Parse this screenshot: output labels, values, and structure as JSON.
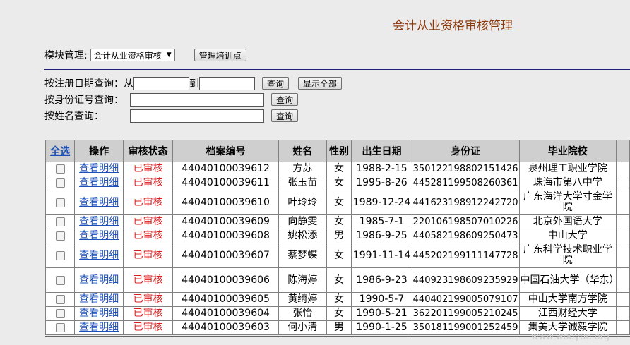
{
  "page_title": "会计从业资格审核管理",
  "module": {
    "label": "模块管理:",
    "selected": "会计从业资格审核",
    "training_button": "管理培训点"
  },
  "queries": {
    "date": {
      "label": "按注册日期查询：从",
      "to": "到",
      "query_button": "查询",
      "show_all_button": "显示全部"
    },
    "id": {
      "label": "按身份证号查询：",
      "query_button": "查询"
    },
    "name": {
      "label": "按姓名查询：",
      "query_button": "查询"
    }
  },
  "table": {
    "headers": [
      "全选",
      "操作",
      "审核状态",
      "档案编号",
      "姓名",
      "性别",
      "出生日期",
      "身份证",
      "毕业院校"
    ],
    "rows": [
      {
        "action": "查看明细",
        "status": "已审核",
        "file_no": "44040100039612",
        "name": "方苏",
        "gender": "女",
        "birth": "1988-2-15",
        "id": "350122198802151426",
        "school": "泉州理工职业学院"
      },
      {
        "action": "查看明细",
        "status": "已审核",
        "file_no": "44040100039611",
        "name": "张玉苗",
        "gender": "女",
        "birth": "1995-8-26",
        "id": "445281199508260361",
        "school": "珠海市第八中学"
      },
      {
        "action": "查看明细",
        "status": "已审核",
        "file_no": "44040100039610",
        "name": "叶玲玲",
        "gender": "女",
        "birth": "1989-12-24",
        "id": "441623198912242720",
        "school": "广东海洋大学寸金学院"
      },
      {
        "action": "查看明细",
        "status": "已审核",
        "file_no": "44040100039609",
        "name": "向静雯",
        "gender": "女",
        "birth": "1985-7-1",
        "id": "220106198507010226",
        "school": "北京外国语大学"
      },
      {
        "action": "查看明细",
        "status": "已审核",
        "file_no": "44040100039608",
        "name": "姚松添",
        "gender": "男",
        "birth": "1986-9-25",
        "id": "440582198609250473",
        "school": "中山大学"
      },
      {
        "action": "查看明细",
        "status": "已审核",
        "file_no": "44040100039607",
        "name": "蔡梦蝶",
        "gender": "女",
        "birth": "1991-11-14",
        "id": "445202199111147728",
        "school": "广东科学技术职业学院"
      },
      {
        "action": "查看明细",
        "status": "已审核",
        "file_no": "44040100039606",
        "name": "陈海婷",
        "gender": "女",
        "birth": "1986-9-23",
        "id": "440923198609235929",
        "school": "中国石油大学（华东）"
      },
      {
        "action": "查看明细",
        "status": "已审核",
        "file_no": "44040100039605",
        "name": "黄绮婷",
        "gender": "女",
        "birth": "1990-5-7",
        "id": "440402199005079107",
        "school": "中山大学南方学院"
      },
      {
        "action": "查看明细",
        "status": "已审核",
        "file_no": "44040100039604",
        "name": "张怡",
        "gender": "女",
        "birth": "1990-5-21",
        "id": "362201199005210245",
        "school": "江西财经大学"
      },
      {
        "action": "查看明细",
        "status": "已审核",
        "file_no": "44040100039603",
        "name": "何小清",
        "gender": "男",
        "birth": "1990-1-25",
        "id": "350181199001252459",
        "school": "集美大学诚毅学院"
      }
    ]
  },
  "watermark": "www.wooyun.org"
}
